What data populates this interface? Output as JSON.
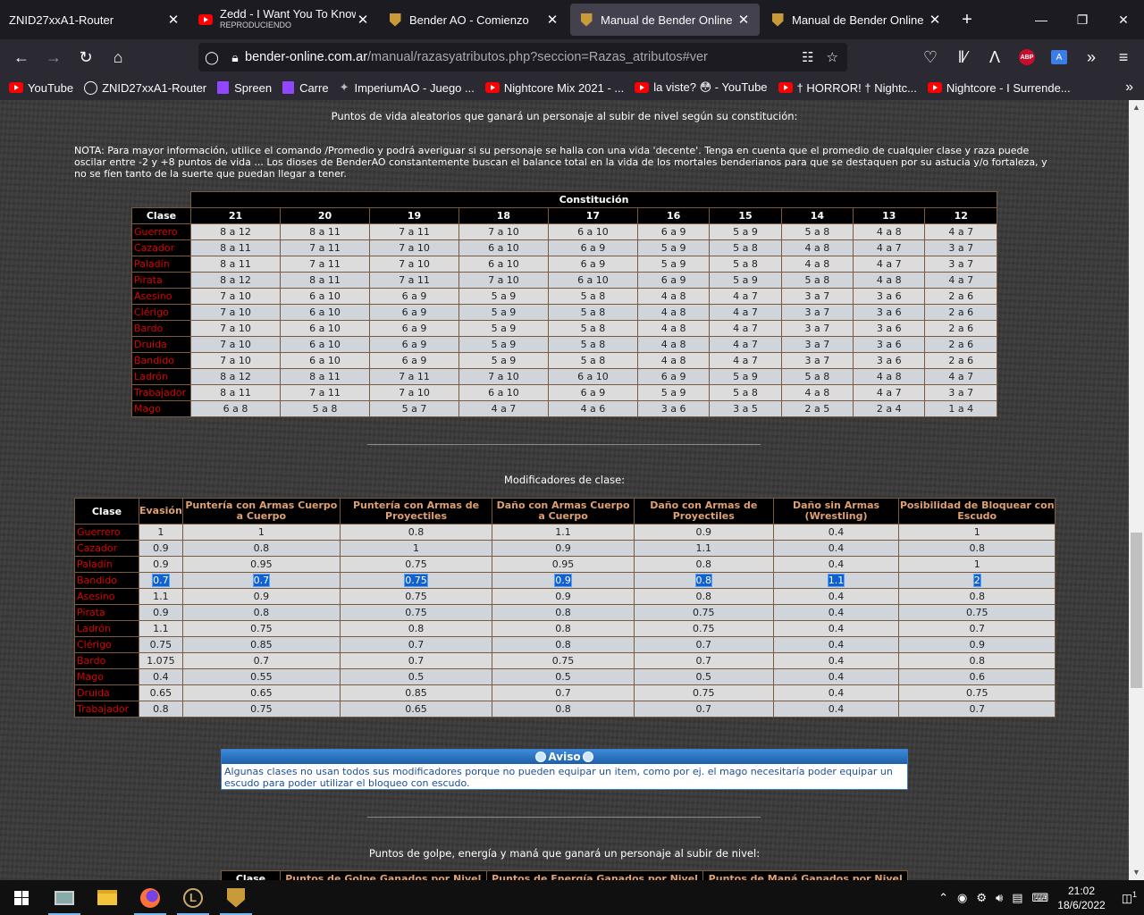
{
  "tabs": [
    {
      "title": "ZNID27xxA1-Router",
      "sub": "",
      "icon": "none",
      "active": false
    },
    {
      "title": "Zedd - I Want You To Know ft",
      "sub": "REPRODUCIENDO",
      "icon": "youtube-icon",
      "active": false
    },
    {
      "title": "Bender AO - Comienzo",
      "sub": "",
      "icon": "bender-shield-icon",
      "active": false
    },
    {
      "title": "Manual de Bender Online",
      "sub": "",
      "icon": "bender-shield-icon",
      "active": true
    },
    {
      "title": "Manual de Bender Online",
      "sub": "",
      "icon": "bender-shield-icon",
      "active": false
    }
  ],
  "url": {
    "host": "bender-online.com.ar",
    "path": "/manual/razasyatributos.php?seccion=Razas_atributos#ver"
  },
  "bookmarks": [
    {
      "label": "YouTube",
      "icon": "youtube-icon"
    },
    {
      "label": "ZNID27xxA1-Router",
      "icon": "globe-icon"
    },
    {
      "label": "Spreen",
      "icon": "twitch-icon"
    },
    {
      "label": "Carre",
      "icon": "twitch-icon"
    },
    {
      "label": "ImperiumAO - Juego ...",
      "icon": "imperium-icon"
    },
    {
      "label": "Nightcore Mix 2021 - ...",
      "icon": "youtube-icon"
    },
    {
      "label": "la viste? 😳 - YouTube",
      "icon": "youtube-icon"
    },
    {
      "label": "† HORROR! † Nightc...",
      "icon": "youtube-icon"
    },
    {
      "label": "Nightcore - I Surrende...",
      "icon": "youtube-icon"
    }
  ],
  "page": {
    "hp_title": "Puntos de vida aleatorios que ganará un personaje al subir de nivel según su constitución:",
    "nota": "NOTA: Para mayor información, utilice el comando /Promedio y podrá averiguar si su personaje se halla con una vida 'decente'. Tenga en cuenta que el promedio de cualquier clase y raza puede oscilar entre -2 y +8 puntos de vida ... Los dioses de BenderAO constantemente buscan el balance total en la vida de los mortales benderianos para que se destaquen por su astucia y/o fortaleza, y no se fíen tanto de la suerte que puedan llegar a tener.",
    "hp_table": {
      "group_header": "Constitución",
      "class_header": "Clase",
      "columns": [
        "21",
        "20",
        "19",
        "18",
        "17",
        "16",
        "15",
        "14",
        "13",
        "12"
      ],
      "rows": [
        {
          "clase": "Guerrero",
          "v": [
            "8 a 12",
            "8 a 11",
            "7 a 11",
            "7 a 10",
            "6 a 10",
            "6 a 9",
            "5 a 9",
            "5 a 8",
            "4 a 8",
            "4 a 7"
          ]
        },
        {
          "clase": "Cazador",
          "v": [
            "8 a 11",
            "7 a 11",
            "7 a 10",
            "6 a 10",
            "6 a 9",
            "5 a 9",
            "5 a 8",
            "4 a 8",
            "4 a 7",
            "3 a 7"
          ]
        },
        {
          "clase": "Paladín",
          "v": [
            "8 a 11",
            "7 a 11",
            "7 a 10",
            "6 a 10",
            "6 a 9",
            "5 a 9",
            "5 a 8",
            "4 a 8",
            "4 a 7",
            "3 a 7"
          ]
        },
        {
          "clase": "Pirata",
          "v": [
            "8 a 12",
            "8 a 11",
            "7 a 11",
            "7 a 10",
            "6 a 10",
            "6 a 9",
            "5 a 9",
            "5 a 8",
            "4 a 8",
            "4 a 7"
          ]
        },
        {
          "clase": "Asesino",
          "v": [
            "7 a 10",
            "6 a 10",
            "6 a 9",
            "5 a 9",
            "5 a 8",
            "4 a 8",
            "4 a 7",
            "3 a 7",
            "3 a 6",
            "2 a 6"
          ]
        },
        {
          "clase": "Clérigo",
          "v": [
            "7 a 10",
            "6 a 10",
            "6 a 9",
            "5 a 9",
            "5 a 8",
            "4 a 8",
            "4 a 7",
            "3 a 7",
            "3 a 6",
            "2 a 6"
          ]
        },
        {
          "clase": "Bardo",
          "v": [
            "7 a 10",
            "6 a 10",
            "6 a 9",
            "5 a 9",
            "5 a 8",
            "4 a 8",
            "4 a 7",
            "3 a 7",
            "3 a 6",
            "2 a 6"
          ]
        },
        {
          "clase": "Druida",
          "v": [
            "7 a 10",
            "6 a 10",
            "6 a 9",
            "5 a 9",
            "5 a 8",
            "4 a 8",
            "4 a 7",
            "3 a 7",
            "3 a 6",
            "2 a 6"
          ]
        },
        {
          "clase": "Bandido",
          "v": [
            "7 a 10",
            "6 a 10",
            "6 a 9",
            "5 a 9",
            "5 a 8",
            "4 a 8",
            "4 a 7",
            "3 a 7",
            "3 a 6",
            "2 a 6"
          ]
        },
        {
          "clase": "Ladrón",
          "v": [
            "8 a 12",
            "8 a 11",
            "7 a 11",
            "7 a 10",
            "6 a 10",
            "6 a 9",
            "5 a 9",
            "5 a 8",
            "4 a 8",
            "4 a 7"
          ]
        },
        {
          "clase": "Trabajador",
          "v": [
            "8 a 11",
            "7 a 11",
            "7 a 10",
            "6 a 10",
            "6 a 9",
            "5 a 9",
            "5 a 8",
            "4 a 8",
            "4 a 7",
            "3 a 7"
          ]
        },
        {
          "clase": "Mago",
          "v": [
            "6 a 8",
            "5 a 8",
            "5 a 7",
            "4 a 7",
            "4 a 6",
            "3 a 6",
            "3 a 5",
            "2 a 5",
            "2 a 4",
            "1 a 4"
          ]
        }
      ]
    },
    "mod_title": "Modificadores de clase:",
    "mod_table": {
      "class_header": "Clase",
      "columns": [
        "Evasión",
        "Puntería con Armas Cuerpo a Cuerpo",
        "Puntería con Armas de Proyectiles",
        "Daño con Armas Cuerpo a Cuerpo",
        "Daño con Armas de Proyectiles",
        "Daño sin Armas (Wrestling)",
        "Posibilidad de Bloquear con Escudo"
      ],
      "rows": [
        {
          "clase": "Guerrero",
          "v": [
            "1",
            "1",
            "0.8",
            "1.1",
            "0.9",
            "0.4",
            "1"
          ]
        },
        {
          "clase": "Cazador",
          "v": [
            "0.9",
            "0.8",
            "1",
            "0.9",
            "1.1",
            "0.4",
            "0.8"
          ]
        },
        {
          "clase": "Paladín",
          "v": [
            "0.9",
            "0.95",
            "0.75",
            "0.95",
            "0.8",
            "0.4",
            "1"
          ]
        },
        {
          "clase": "Bandido",
          "v": [
            "0.7",
            "0.7",
            "0.75",
            "0.9",
            "0.8",
            "1.1",
            "2"
          ],
          "selected": true
        },
        {
          "clase": "Asesino",
          "v": [
            "1.1",
            "0.9",
            "0.75",
            "0.9",
            "0.8",
            "0.4",
            "0.8"
          ]
        },
        {
          "clase": "Pirata",
          "v": [
            "0.9",
            "0.8",
            "0.75",
            "0.8",
            "0.75",
            "0.4",
            "0.75"
          ]
        },
        {
          "clase": "Ladrón",
          "v": [
            "1.1",
            "0.75",
            "0.8",
            "0.8",
            "0.75",
            "0.4",
            "0.7"
          ]
        },
        {
          "clase": "Clérigo",
          "v": [
            "0.75",
            "0.85",
            "0.7",
            "0.8",
            "0.7",
            "0.4",
            "0.9"
          ]
        },
        {
          "clase": "Bardo",
          "v": [
            "1.075",
            "0.7",
            "0.7",
            "0.75",
            "0.7",
            "0.4",
            "0.8"
          ]
        },
        {
          "clase": "Mago",
          "v": [
            "0.4",
            "0.55",
            "0.5",
            "0.5",
            "0.5",
            "0.4",
            "0.6"
          ]
        },
        {
          "clase": "Druida",
          "v": [
            "0.65",
            "0.65",
            "0.85",
            "0.7",
            "0.75",
            "0.4",
            "0.75"
          ]
        },
        {
          "clase": "Trabajador",
          "v": [
            "0.8",
            "0.75",
            "0.65",
            "0.8",
            "0.7",
            "0.4",
            "0.7"
          ]
        }
      ]
    },
    "aviso": {
      "title": "Aviso",
      "body": "Algunas clases no usan todos sus modificadores porque no pueden equipar un item, como por ej. el mago necesitaría poder equipar un escudo para poder utilizar el bloqueo con escudo."
    },
    "golpe_title": "Puntos de golpe, energía y maná que ganará un personaje al subir de nivel:",
    "golpe_headers": [
      "Clase",
      "Puntos de Golpe Ganados por Nivel",
      "Puntos de Energía Ganados por Nivel",
      "Puntos de Maná Ganados por Nivel"
    ]
  },
  "taskbar": {
    "time": "21:02",
    "date": "18/6/2022",
    "notif_count": "1"
  },
  "colors": {
    "accent": "#1060d0",
    "class_red": "#e00000",
    "header_orange": "#e0a070",
    "aviso_blue": "#3d8ad8"
  }
}
